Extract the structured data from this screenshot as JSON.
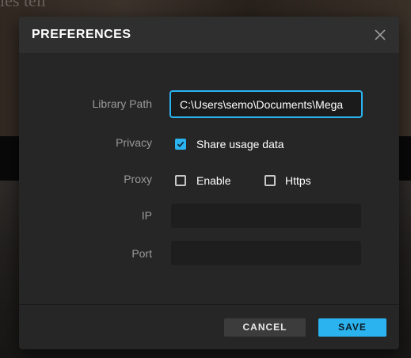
{
  "background": {
    "partial_text": "ies tell"
  },
  "dialog": {
    "title": "PREFERENCES",
    "close_icon": "close-icon"
  },
  "fields": {
    "library_path": {
      "label": "Library Path",
      "value": "C:\\Users\\semo\\Documents\\Mega"
    },
    "privacy": {
      "label": "Privacy",
      "share_usage_label": "Share usage data",
      "share_usage_checked": true
    },
    "proxy": {
      "label": "Proxy",
      "enable_label": "Enable",
      "enable_checked": false,
      "https_label": "Https",
      "https_checked": false
    },
    "ip": {
      "label": "IP",
      "value": ""
    },
    "port": {
      "label": "Port",
      "value": ""
    }
  },
  "buttons": {
    "cancel": "CANCEL",
    "save": "SAVE"
  },
  "colors": {
    "accent": "#2bb3f0",
    "dialog_bg": "#262626",
    "header_bg": "#2f2f2f",
    "input_bg": "#1e1e1e"
  }
}
